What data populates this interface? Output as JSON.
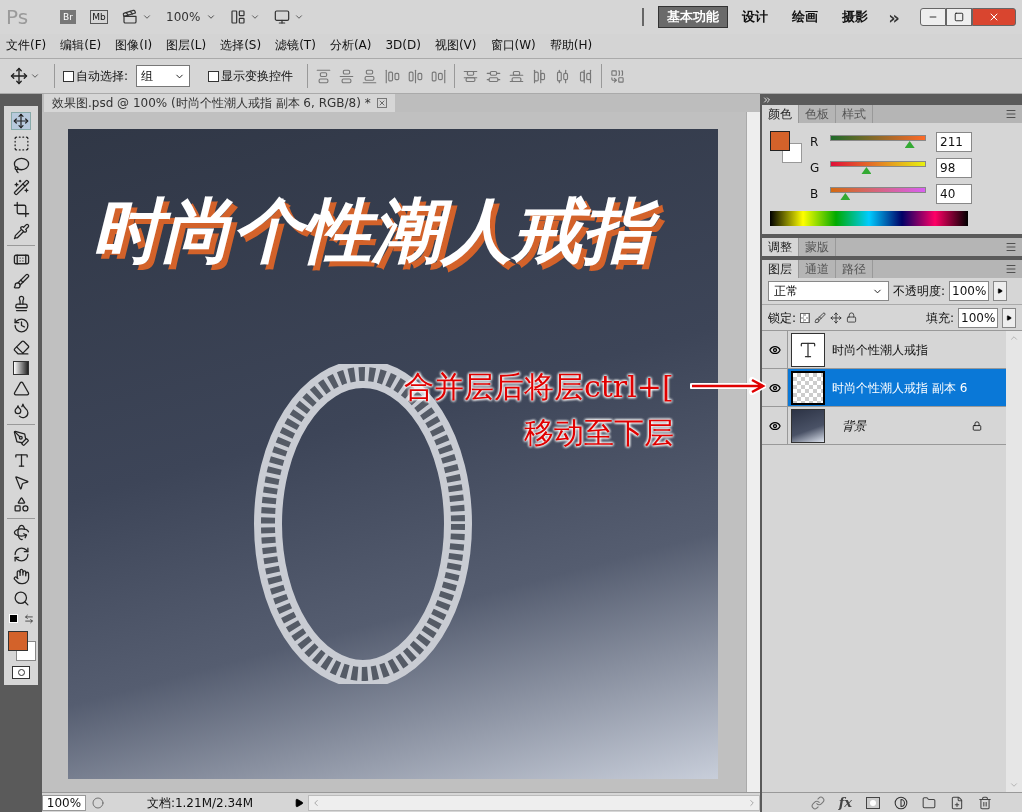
{
  "app_bar": {
    "logo": "Ps",
    "bridge": "Br",
    "mini_bridge": "Mb",
    "zoom": "100%",
    "workspaces": [
      {
        "label": "基本功能",
        "selected": true
      },
      {
        "label": "设计",
        "selected": false
      },
      {
        "label": "绘画",
        "selected": false
      },
      {
        "label": "摄影",
        "selected": false
      }
    ],
    "more": "»"
  },
  "menu": [
    "文件(F)",
    "编辑(E)",
    "图像(I)",
    "图层(L)",
    "选择(S)",
    "滤镜(T)",
    "分析(A)",
    "3D(D)",
    "视图(V)",
    "窗口(W)",
    "帮助(H)"
  ],
  "options_bar": {
    "auto_select": {
      "label": "自动选择:",
      "checked": false
    },
    "auto_select_value": "组",
    "show_transform": {
      "label": "显示变换控件",
      "checked": false
    }
  },
  "document": {
    "tab_title": "效果图.psd @ 100% (时尚个性潮人戒指 副本 6, RGB/8) *",
    "title_overlay": "时尚个性潮人戒指",
    "annotation": [
      "合并层后将层ctrl+[",
      "移动至下层"
    ]
  },
  "status_bar": {
    "zoom": "100%",
    "doc_info": "文档:1.21M/2.34M"
  },
  "color_panel": {
    "tabs": [
      {
        "label": "颜色",
        "selected": true
      },
      {
        "label": "色板",
        "selected": false
      },
      {
        "label": "样式",
        "selected": false
      }
    ],
    "channels": [
      {
        "label": "R",
        "value": "211",
        "level": 0.83
      },
      {
        "label": "G",
        "value": "98",
        "level": 0.38
      },
      {
        "label": "B",
        "value": "40",
        "level": 0.16
      }
    ]
  },
  "adjust_panel": {
    "tabs": [
      {
        "label": "调整",
        "selected": true
      },
      {
        "label": "蒙版",
        "selected": false
      }
    ]
  },
  "layers_panel": {
    "tabs": [
      {
        "label": "图层",
        "selected": true
      },
      {
        "label": "通道",
        "selected": false
      },
      {
        "label": "路径",
        "selected": false
      }
    ],
    "blend_mode": "正常",
    "opacity_label": "不透明度:",
    "opacity": "100%",
    "lock_label": "锁定:",
    "fill_label": "填充:",
    "fill": "100%",
    "layers": [
      {
        "name": "时尚个性潮人戒指",
        "kind": "text",
        "selected": false,
        "visible": true,
        "locked": false
      },
      {
        "name": "时尚个性潮人戒指 副本 6",
        "kind": "pixel",
        "selected": true,
        "visible": true,
        "locked": false
      },
      {
        "name": "背景",
        "kind": "background",
        "selected": false,
        "visible": true,
        "locked": true
      }
    ],
    "fx": "fx"
  }
}
